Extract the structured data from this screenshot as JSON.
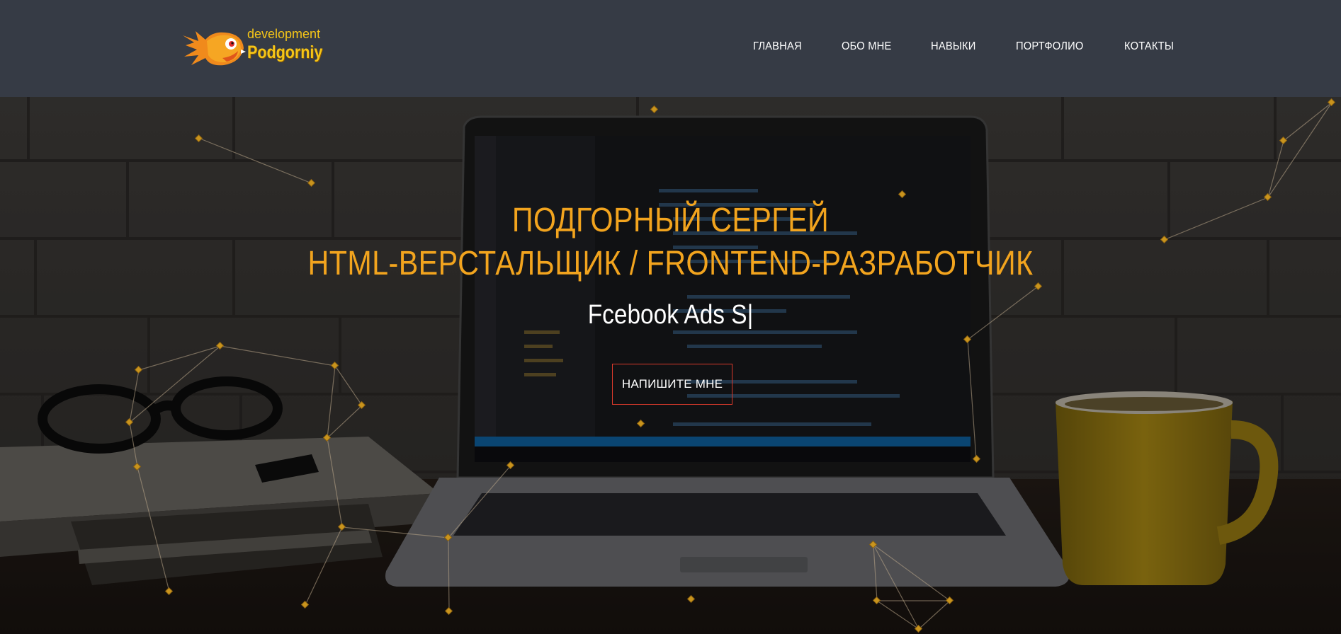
{
  "header": {
    "logo": {
      "top_text": "development",
      "name_text": "Podgorniy",
      "icon": "fish-logo-icon"
    },
    "nav": [
      {
        "label": "ГЛАВНАЯ"
      },
      {
        "label": "ОБО МНЕ"
      },
      {
        "label": "НАВЫКИ"
      },
      {
        "label": "ПОРТФОЛИО"
      },
      {
        "label": "КОТАКТЫ"
      }
    ]
  },
  "hero": {
    "name": "ПОДГОРНЫЙ СЕРГЕЙ",
    "role": "HTML-ВЕРСТАЛЬЩИК / FRONTEND-РАЗРАБОТЧИК",
    "typed_text": "Fcebook Ads S|",
    "cta_label": "НАПИШИТЕ МНЕ",
    "background": "desk-laptop-photo",
    "particles": "particle-network"
  },
  "colors": {
    "header_bg": "#363b45",
    "accent": "#f2a41e",
    "cta_border": "#d9392b",
    "text": "#ffffff"
  }
}
